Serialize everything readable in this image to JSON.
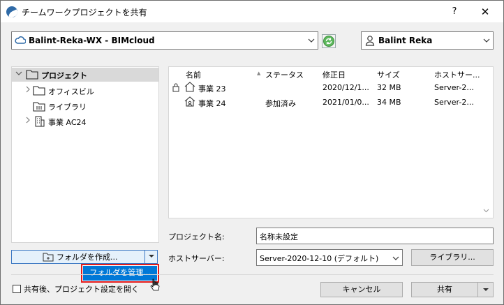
{
  "window": {
    "title": "チームワークプロジェクトを共有",
    "help_label": "?",
    "close_label": "✕"
  },
  "server_combo": {
    "value": "Balint-Reka-WX - BIMcloud",
    "icon": "cloud-icon"
  },
  "sync_button": {
    "icon": "sync-icon"
  },
  "user_combo": {
    "value": "Balint Reka",
    "icon": "user-icon"
  },
  "tree": {
    "items": [
      {
        "label": "プロジェクト",
        "icon": "folder-icon",
        "selected": true
      },
      {
        "label": "オフィスビル",
        "icon": "folder-icon"
      },
      {
        "label": "ライブラリ",
        "icon": "library-icon"
      },
      {
        "label": "事業 AC24",
        "icon": "building-icon"
      }
    ]
  },
  "list": {
    "columns": [
      "名前",
      "ステータス",
      "修正日",
      "サイズ",
      "ホストサー..."
    ],
    "rows": [
      {
        "name": "事業 23",
        "status": "",
        "modified": "2020/12/1...",
        "size": "32 MB",
        "host": "Server-2..."
      },
      {
        "name": "事業 24",
        "status": "参加済み",
        "modified": "2021/01/0...",
        "size": "34 MB",
        "host": "Server-2..."
      }
    ]
  },
  "form": {
    "project_name_label": "プロジェクト名:",
    "project_name_value": "名称未設定",
    "host_server_label": "ホストサーバー:",
    "host_server_value": "Server-2020-12-10 (デフォルト)",
    "library_button": "ライブラリ..."
  },
  "create_folder_button": "フォルダを作成...",
  "dropdown_menu": {
    "manage_folders": "フォルダを管理..."
  },
  "footer": {
    "open_settings_checkbox": "共有後、プロジェクト設定を開く",
    "cancel_button": "キャンセル",
    "share_button": "共有"
  },
  "colors": {
    "accent": "#0078d7",
    "highlight_border": "#e21b1b",
    "sync_green": "#4caf50"
  }
}
